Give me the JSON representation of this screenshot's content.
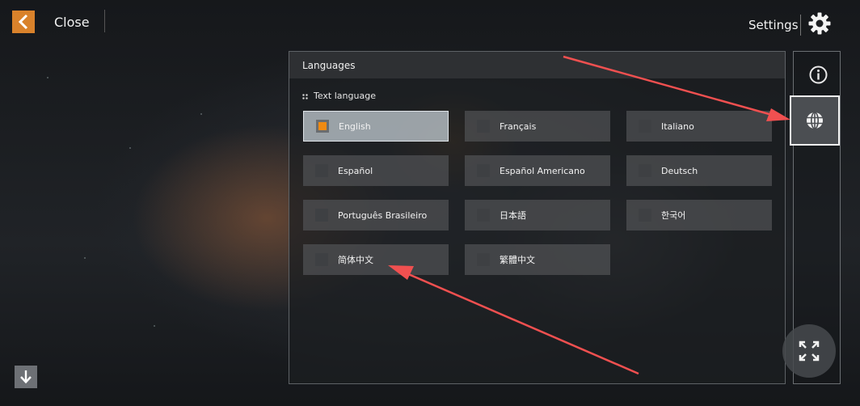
{
  "topbar": {
    "close_label": "Close",
    "settings_label": "Settings",
    "back_icon": "chevron-left-icon",
    "settings_icon": "gear-icon"
  },
  "panel": {
    "title": "Languages",
    "section_label": "Text language",
    "languages": [
      {
        "label": "English",
        "selected": true
      },
      {
        "label": "Français",
        "selected": false
      },
      {
        "label": "Italiano",
        "selected": false
      },
      {
        "label": "Español",
        "selected": false
      },
      {
        "label": "Español Americano",
        "selected": false
      },
      {
        "label": "Deutsch",
        "selected": false
      },
      {
        "label": "Português Brasileiro",
        "selected": false
      },
      {
        "label": "日本語",
        "selected": false
      },
      {
        "label": "한국어",
        "selected": false
      },
      {
        "label": "简体中文",
        "selected": false
      },
      {
        "label": "繁體中文",
        "selected": false
      }
    ]
  },
  "rail": {
    "info_icon": "info-icon",
    "language_icon": "globe-icon",
    "fullscreen_icon": "fullscreen-icon"
  },
  "bottom": {
    "down_icon": "arrow-down-icon"
  },
  "colors": {
    "accent": "#f08a12",
    "back_button": "#d9822b",
    "annotation_arrow": "#f05050"
  }
}
